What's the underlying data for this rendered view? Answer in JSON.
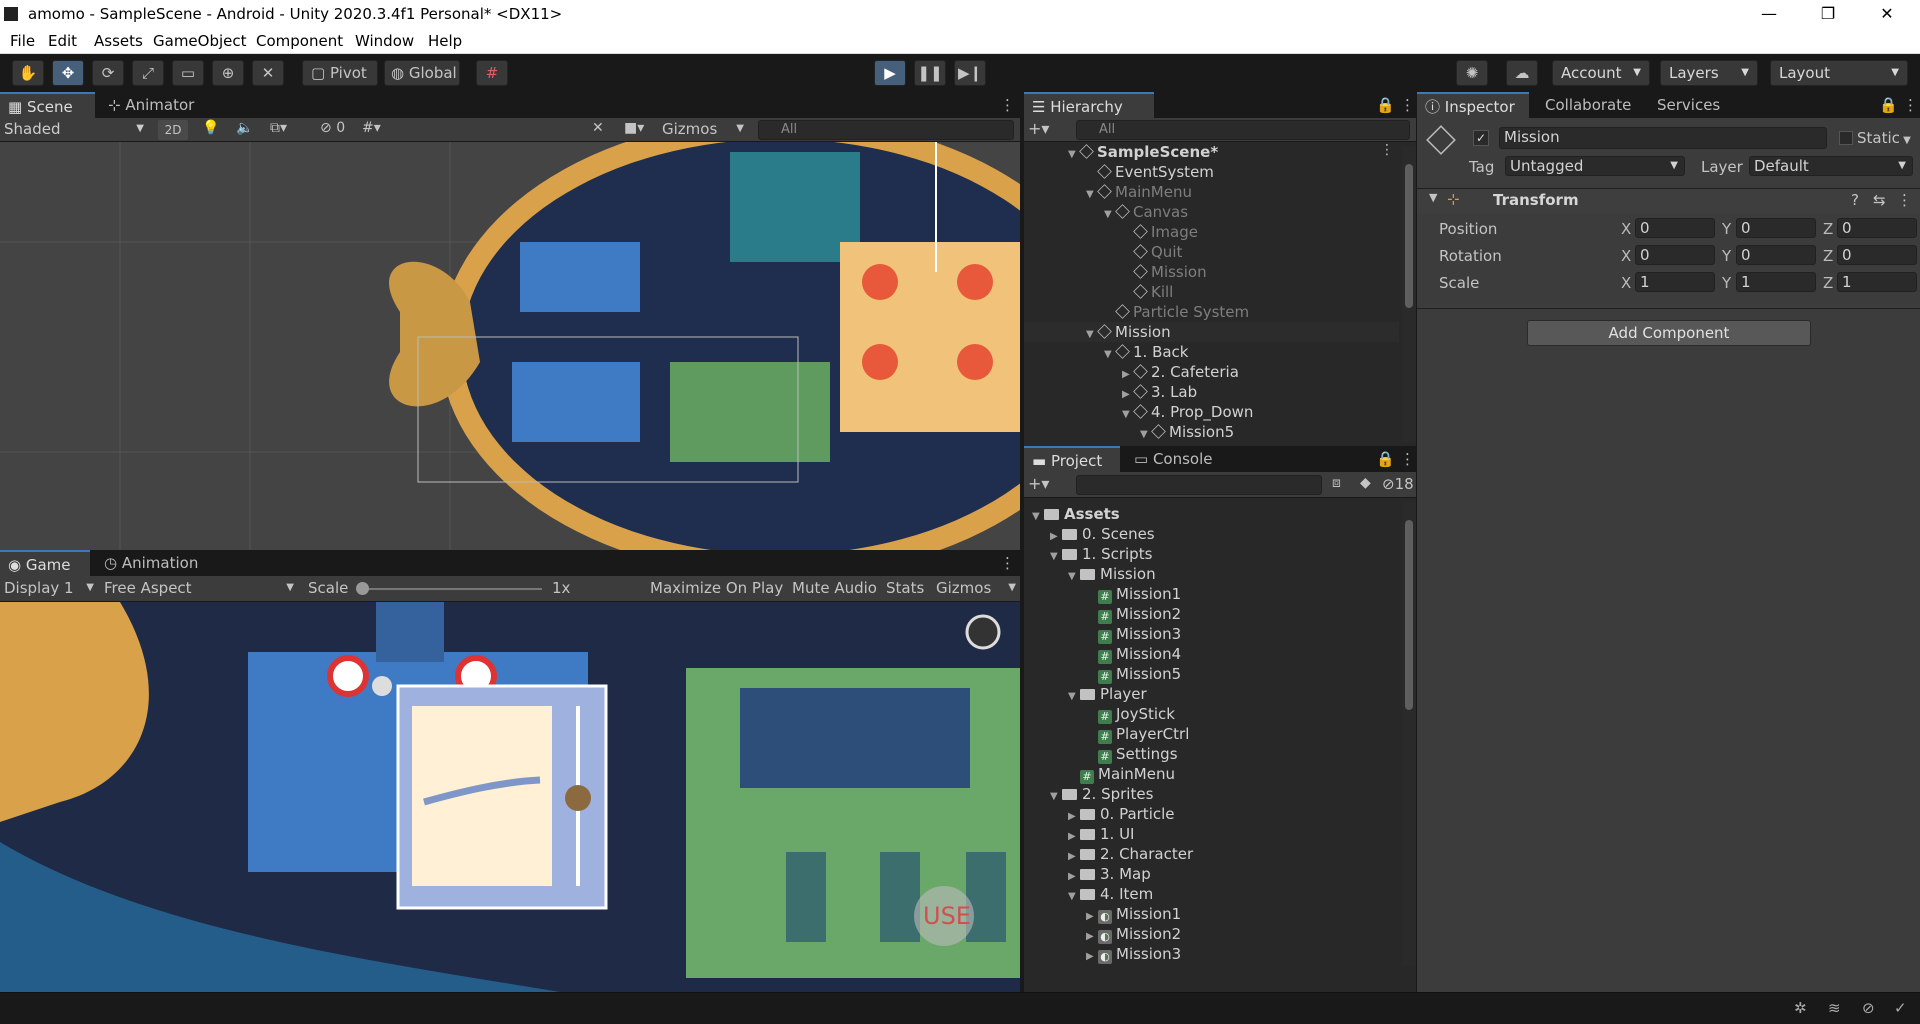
{
  "window": {
    "title": "amomo - SampleScene - Android - Unity 2020.3.4f1 Personal* <DX11>",
    "minimize": "—",
    "maximize": "❐",
    "close": "✕"
  },
  "menu": [
    "File",
    "Edit",
    "Assets",
    "GameObject",
    "Component",
    "Window",
    "Help"
  ],
  "toolbar": {
    "pivot": "Pivot",
    "global": "Global",
    "account": "Account",
    "layers": "Layers",
    "layout": "Layout"
  },
  "scene": {
    "tabs": [
      "Scene",
      "Animator"
    ],
    "shading": "Shaded",
    "mode_2d": "2D",
    "hidden_count": "0",
    "gizmos": "Gizmos",
    "search_placeholder": "All"
  },
  "game": {
    "tabs": [
      "Game",
      "Animation"
    ],
    "display": "Display 1",
    "aspect": "Free Aspect",
    "scale_label": "Scale",
    "scale_value": "1x",
    "maximize": "Maximize On Play",
    "mute": "Mute Audio",
    "stats": "Stats",
    "gizmos": "Gizmos",
    "use_button": "USE"
  },
  "hierarchy": {
    "tab": "Hierarchy",
    "search_placeholder": "All",
    "items": [
      {
        "label": "SampleScene*",
        "indent": 0,
        "arrow": "▼",
        "dim": false,
        "scene": true
      },
      {
        "label": "EventSystem",
        "indent": 1,
        "arrow": "",
        "dim": false
      },
      {
        "label": "MainMenu",
        "indent": 1,
        "arrow": "▼",
        "dim": true
      },
      {
        "label": "Canvas",
        "indent": 2,
        "arrow": "▼",
        "dim": true
      },
      {
        "label": "Image",
        "indent": 3,
        "arrow": "",
        "dim": true
      },
      {
        "label": "Quit",
        "indent": 3,
        "arrow": "",
        "dim": true
      },
      {
        "label": "Mission",
        "indent": 3,
        "arrow": "",
        "dim": true
      },
      {
        "label": "Kill",
        "indent": 3,
        "arrow": "",
        "dim": true
      },
      {
        "label": "Particle System",
        "indent": 2,
        "arrow": "",
        "dim": true
      },
      {
        "label": "Mission",
        "indent": 1,
        "arrow": "▼",
        "dim": false,
        "selected": true
      },
      {
        "label": "1. Back",
        "indent": 2,
        "arrow": "▼",
        "dim": false
      },
      {
        "label": "2. Cafeteria",
        "indent": 3,
        "arrow": "▶",
        "dim": false
      },
      {
        "label": "3. Lab",
        "indent": 3,
        "arrow": "▶",
        "dim": false
      },
      {
        "label": "4. Prop_Down",
        "indent": 3,
        "arrow": "▼",
        "dim": false
      },
      {
        "label": "Mission5",
        "indent": 4,
        "arrow": "▼",
        "dim": false
      }
    ]
  },
  "project": {
    "tabs": [
      "Project",
      "Console"
    ],
    "hidden_count": "18",
    "items": [
      {
        "label": "Assets",
        "indent": 0,
        "arrow": "▼",
        "kind": "folder",
        "bold": true
      },
      {
        "label": "0. Scenes",
        "indent": 1,
        "arrow": "▶",
        "kind": "folder"
      },
      {
        "label": "1. Scripts",
        "indent": 1,
        "arrow": "▼",
        "kind": "folder"
      },
      {
        "label": "Mission",
        "indent": 2,
        "arrow": "▼",
        "kind": "folder"
      },
      {
        "label": "Mission1",
        "indent": 3,
        "arrow": "",
        "kind": "script"
      },
      {
        "label": "Mission2",
        "indent": 3,
        "arrow": "",
        "kind": "script"
      },
      {
        "label": "Mission3",
        "indent": 3,
        "arrow": "",
        "kind": "script"
      },
      {
        "label": "Mission4",
        "indent": 3,
        "arrow": "",
        "kind": "script"
      },
      {
        "label": "Mission5",
        "indent": 3,
        "arrow": "",
        "kind": "script"
      },
      {
        "label": "Player",
        "indent": 2,
        "arrow": "▼",
        "kind": "folder"
      },
      {
        "label": "JoyStick",
        "indent": 3,
        "arrow": "",
        "kind": "script"
      },
      {
        "label": "PlayerCtrl",
        "indent": 3,
        "arrow": "",
        "kind": "script"
      },
      {
        "label": "Settings",
        "indent": 3,
        "arrow": "",
        "kind": "script"
      },
      {
        "label": "MainMenu",
        "indent": 2,
        "arrow": "",
        "kind": "script"
      },
      {
        "label": "2. Sprites",
        "indent": 1,
        "arrow": "▼",
        "kind": "folder"
      },
      {
        "label": "0. Particle",
        "indent": 2,
        "arrow": "▶",
        "kind": "folder"
      },
      {
        "label": "1. UI",
        "indent": 2,
        "arrow": "▶",
        "kind": "folder"
      },
      {
        "label": "2. Character",
        "indent": 2,
        "arrow": "▶",
        "kind": "folder"
      },
      {
        "label": "3. Map",
        "indent": 2,
        "arrow": "▶",
        "kind": "folder"
      },
      {
        "label": "4. Item",
        "indent": 2,
        "arrow": "▼",
        "kind": "folder"
      },
      {
        "label": "Mission1",
        "indent": 3,
        "arrow": "▶",
        "kind": "sprite"
      },
      {
        "label": "Mission2",
        "indent": 3,
        "arrow": "▶",
        "kind": "sprite"
      },
      {
        "label": "Mission3",
        "indent": 3,
        "arrow": "▶",
        "kind": "sprite"
      }
    ]
  },
  "inspector": {
    "tabs": [
      "Inspector",
      "Collaborate",
      "Services"
    ],
    "object_name": "Mission",
    "static_label": "Static",
    "tag_label": "Tag",
    "tag_value": "Untagged",
    "layer_label": "Layer",
    "layer_value": "Default",
    "component": "Transform",
    "rows": [
      {
        "label": "Position",
        "x": "0",
        "y": "0",
        "z": "0"
      },
      {
        "label": "Rotation",
        "x": "0",
        "y": "0",
        "z": "0"
      },
      {
        "label": "Scale",
        "x": "1",
        "y": "1",
        "z": "1"
      }
    ],
    "axes": [
      "X",
      "Y",
      "Z"
    ],
    "add_component": "Add Component"
  }
}
